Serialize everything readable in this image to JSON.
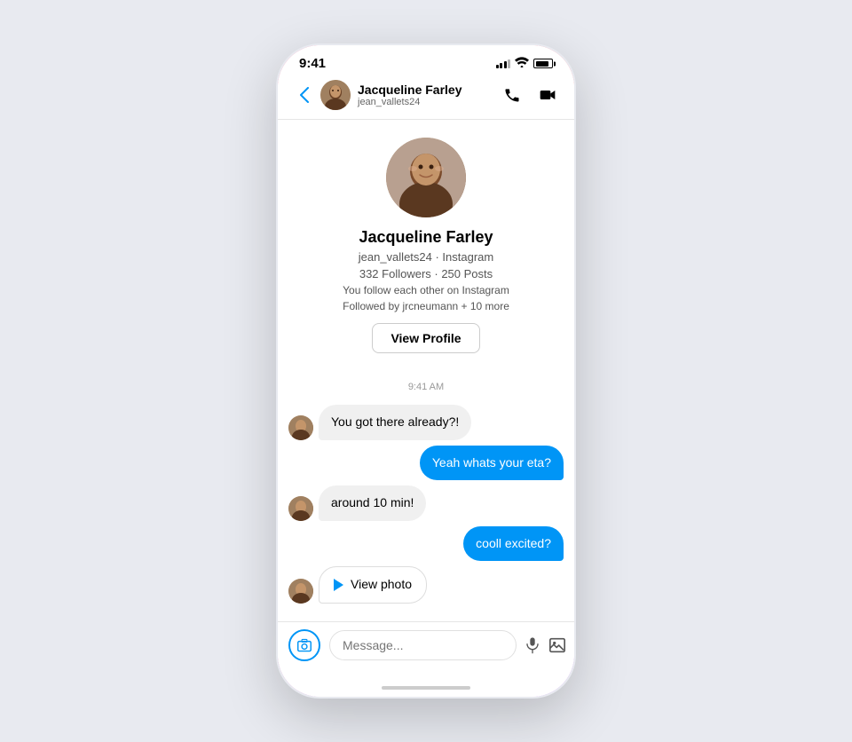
{
  "status_bar": {
    "time": "9:41"
  },
  "nav": {
    "back_label": "‹",
    "username": "Jacqueline Farley",
    "handle": "jean_vallets24"
  },
  "profile": {
    "name": "Jacqueline Farley",
    "handle_instagram": "jean_vallets24 · Instagram",
    "stats": "332 Followers · 250 Posts",
    "follow_status": "You follow each other on Instagram",
    "followed_by": "Followed by jrcneumann + 10 more",
    "view_profile_label": "View Profile"
  },
  "messages": {
    "timestamp": "9:41 AM",
    "items": [
      {
        "type": "received",
        "text": "You got there already?!"
      },
      {
        "type": "sent",
        "text": "Yeah whats your eta?"
      },
      {
        "type": "received",
        "text": "around 10 min!"
      },
      {
        "type": "sent",
        "text": "cooll excited?"
      },
      {
        "type": "received_photo",
        "text": "View photo"
      }
    ]
  },
  "input_bar": {
    "placeholder": "Message..."
  }
}
